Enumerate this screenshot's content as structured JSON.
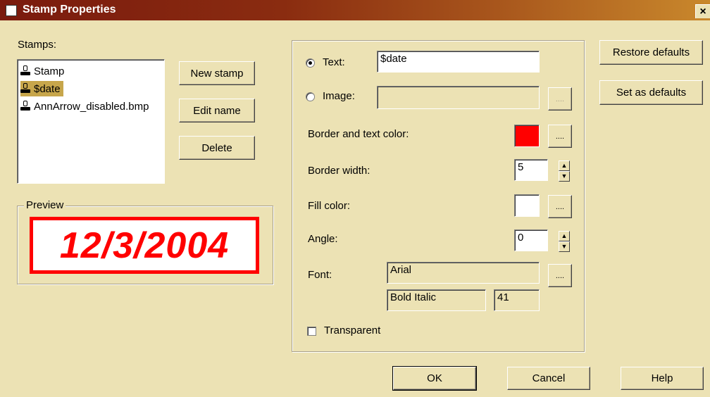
{
  "window": {
    "title": "Stamp Properties",
    "close_glyph": "×"
  },
  "stamps": {
    "label": "Stamps:",
    "items": [
      {
        "label": "Stamp",
        "icon": "stamp-icon",
        "selected": false
      },
      {
        "label": "$date",
        "icon": "stamp-icon",
        "selected": true
      },
      {
        "label": "AnnArrow_disabled.bmp",
        "icon": "stamp-icon",
        "selected": false
      }
    ],
    "new_label": "New stamp",
    "edit_label": "Edit name",
    "delete_label": "Delete"
  },
  "preview": {
    "label": "Preview",
    "text": "12/3/2004",
    "color": "#ff0000"
  },
  "props": {
    "text_label": "Text:",
    "text_value": "$date",
    "image_label": "Image:",
    "image_value": "",
    "browse_glyph": "....",
    "border_color_label": "Border and text color:",
    "border_color": "#ff0000",
    "border_width_label": "Border width:",
    "border_width_value": "5",
    "fill_color_label": "Fill color:",
    "fill_color": "#ffffff",
    "angle_label": "Angle:",
    "angle_value": "0",
    "font_label": "Font:",
    "font_name": "Arial",
    "font_style": "Bold Italic",
    "font_size": "41",
    "transparent_label": "Transparent"
  },
  "side": {
    "restore_label": "Restore defaults",
    "set_label": "Set as defaults"
  },
  "footer": {
    "ok_label": "OK",
    "cancel_label": "Cancel",
    "help_label": "Help"
  }
}
